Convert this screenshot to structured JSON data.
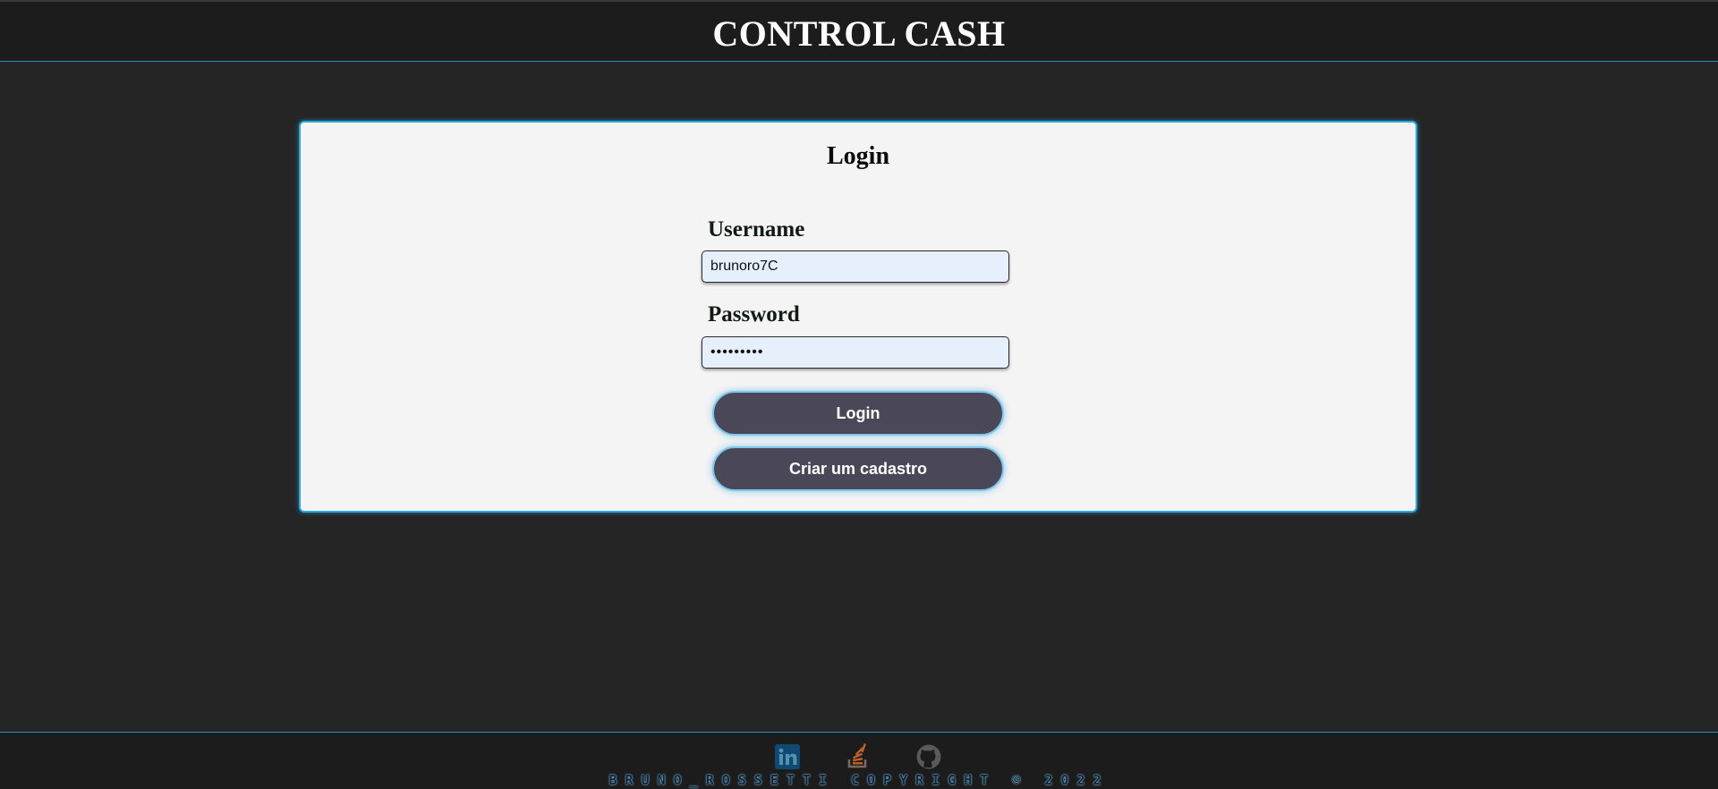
{
  "header": {
    "title": "CONTROL CASH"
  },
  "login": {
    "title": "Login",
    "username_label": "Username",
    "username_value": "brunoro7C",
    "password_label": "Password",
    "password_value": "•••••••••",
    "login_button": "Login",
    "register_button": "Criar um cadastro"
  },
  "footer": {
    "copyright": "BRUNO_ROSSETTI COPYRIGHT © 2022",
    "icons": [
      "linkedin-icon",
      "stackoverflow-icon",
      "github-icon"
    ]
  },
  "colors": {
    "accent": "#2aa6e0",
    "button": "#4a4858",
    "background": "#252525",
    "card": "#f4f4f4"
  }
}
